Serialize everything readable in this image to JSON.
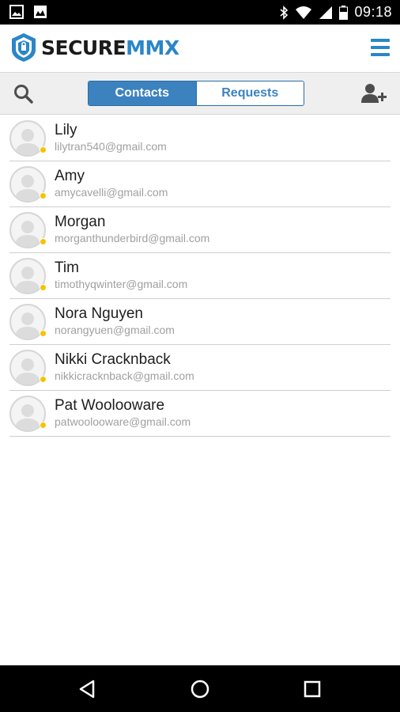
{
  "status_bar": {
    "time": "09:18",
    "left_icons": [
      "image-icon",
      "photo-icon"
    ],
    "right_icons": [
      "bluetooth-icon",
      "wifi-icon",
      "signal-icon",
      "battery-icon"
    ]
  },
  "header": {
    "logo_word_secure": "SECURE",
    "logo_word_mmx": "MMX",
    "brand_colors": {
      "dark": "#1a1a1a",
      "blue": "#2a86c8"
    }
  },
  "toolbar": {
    "tabs": [
      {
        "label": "Contacts",
        "active": true
      },
      {
        "label": "Requests",
        "active": false
      }
    ],
    "accent": "#3c82be"
  },
  "contacts": [
    {
      "name": "Lily",
      "email": "lilytran540@gmail.com",
      "status": "away"
    },
    {
      "name": "Amy",
      "email": "amycavelli@gmail.com",
      "status": "away"
    },
    {
      "name": "Morgan",
      "email": "morganthunderbird@gmail.com",
      "status": "away"
    },
    {
      "name": "Tim",
      "email": "timothyqwinter@gmail.com",
      "status": "away"
    },
    {
      "name": "Nora Nguyen",
      "email": "norangyuen@gmail.com",
      "status": "away"
    },
    {
      "name": "Nikki Cracknback",
      "email": "nikkicracknback@gmail.com",
      "status": "away"
    },
    {
      "name": "Pat Woolooware",
      "email": "patwoolooware@gmail.com",
      "status": "away"
    }
  ],
  "status_color": "#f5c400",
  "nav_bar": {
    "buttons": [
      "back-icon",
      "home-icon",
      "recents-icon"
    ]
  }
}
